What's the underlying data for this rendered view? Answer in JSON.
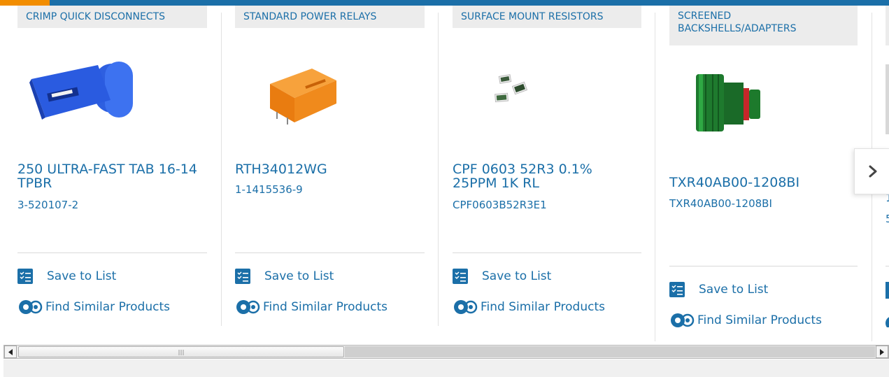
{
  "colors": {
    "accent": "#1b6fa8",
    "brand_orange": "#f28d00",
    "tag_bg": "#ececec"
  },
  "carousel": {
    "cards": [
      {
        "category": "CRIMP QUICK DISCONNECTS",
        "title": "250 ULTRA-FAST TAB 16-14 TPBR",
        "part_number": "3-520107-2",
        "save_label": "Save to List",
        "similar_label": "Find Similar Products",
        "image": "blue-quick-disconnect"
      },
      {
        "category": "STANDARD POWER RELAYS",
        "title": "RTH34012WG",
        "part_number": "1-1415536-9",
        "save_label": "Save to List",
        "similar_label": "Find Similar Products",
        "image": "orange-relay"
      },
      {
        "category": "SURFACE MOUNT RESISTORS",
        "title": "CPF 0603 52R3 0.1% 25PPM 1K RL",
        "part_number": "CPF0603B52R3E1",
        "save_label": "Save to List",
        "similar_label": "Find Similar Products",
        "image": "smd-resistors"
      },
      {
        "category": "SCREENED BACKSHELLS/ADAPTERS",
        "title": "TXR40AB00-1208BI",
        "part_number": "TXR40AB00-1208BI",
        "save_label": "Save to List",
        "similar_label": "Find Similar Products",
        "image": "green-backshell"
      }
    ],
    "partial_card": {
      "title_fragment": "1",
      "part_fragment": "5"
    },
    "next_icon": "chevron-right-icon"
  },
  "scrollbar": {
    "left_icon": "arrow-left-icon",
    "right_icon": "arrow-right-icon"
  }
}
